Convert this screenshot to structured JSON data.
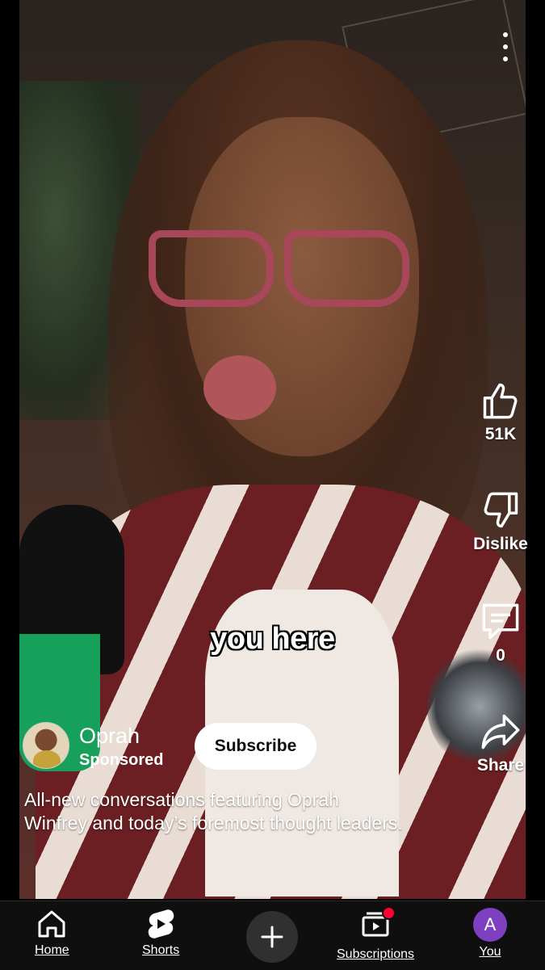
{
  "video": {
    "caption": "you here"
  },
  "actions": {
    "like_count": "51K",
    "dislike_label": "Dislike",
    "comment_count": "0",
    "share_label": "Share"
  },
  "channel": {
    "name": "Oprah",
    "sponsored_label": "Sponsored",
    "subscribe_label": "Subscribe",
    "avatar_icon": "channel-avatar"
  },
  "description": "All-new conversations featuring Oprah Winfrey and today’s foremost thought leaders.",
  "nav": {
    "home": "Home",
    "shorts": "Shorts",
    "create_icon": "plus-icon",
    "subscriptions": "Subscriptions",
    "you": "You",
    "you_initial": "A"
  },
  "colors": {
    "nav_background": "#0f0f0f",
    "you_avatar": "#7e3fc0",
    "notification": "#ff0033",
    "subscribe_bg": "#ffffff"
  }
}
